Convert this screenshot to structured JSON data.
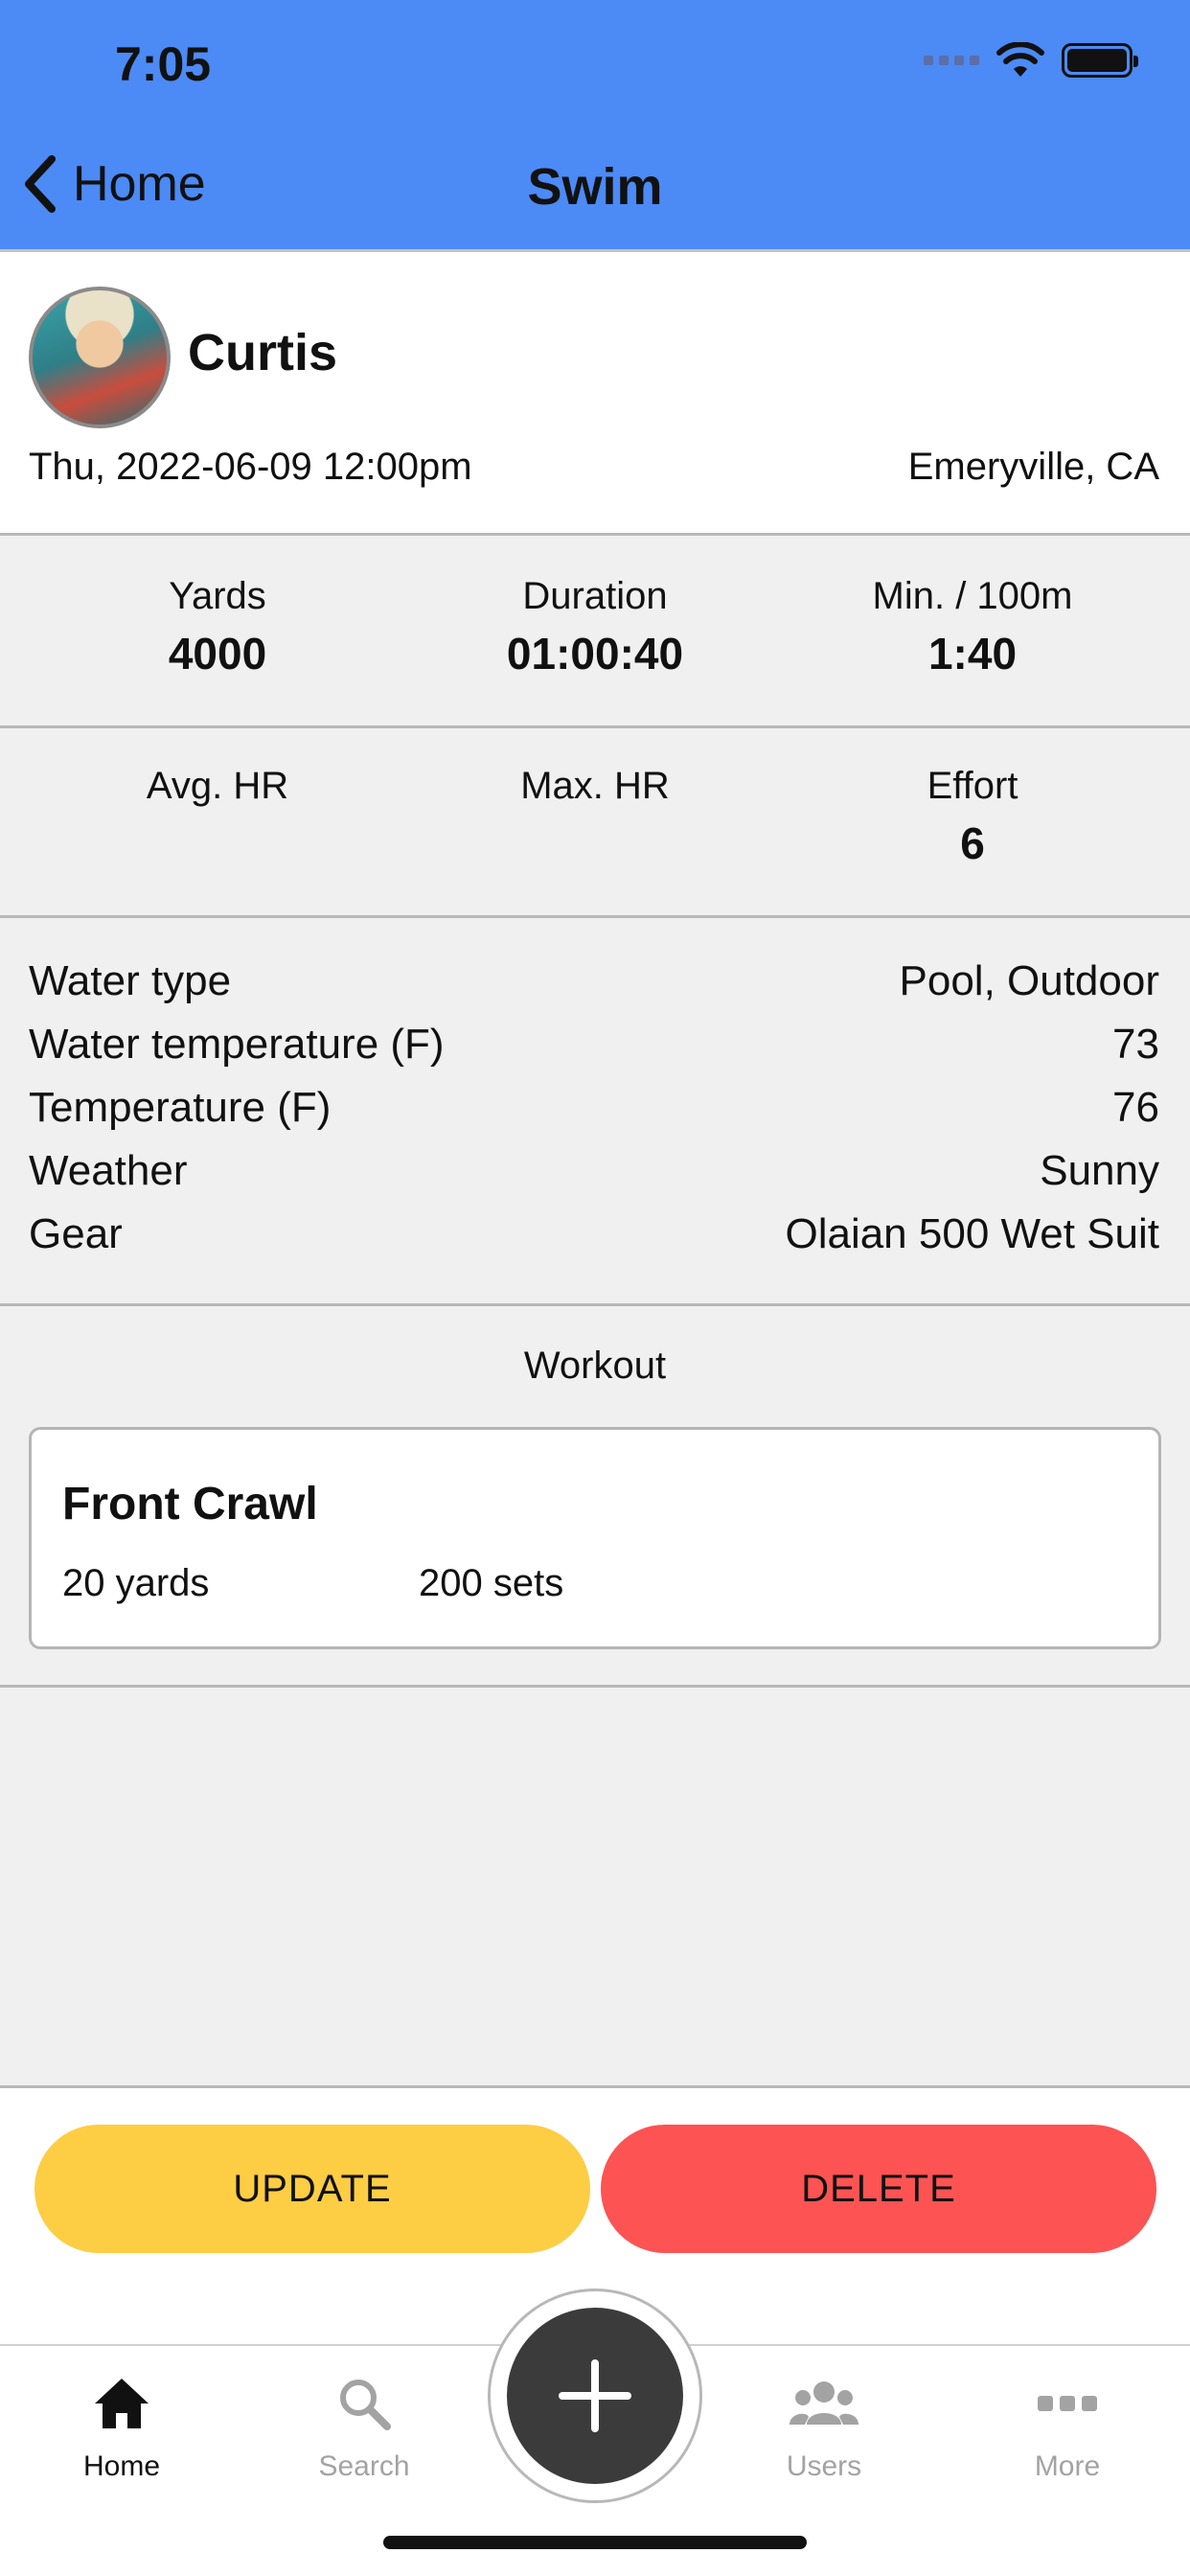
{
  "status_bar": {
    "time": "7:05"
  },
  "nav": {
    "back_label": "Home",
    "title": "Swim"
  },
  "profile": {
    "name": "Curtis",
    "datetime": "Thu, 2022-06-09 12:00pm",
    "location": "Emeryville, CA"
  },
  "stats": [
    {
      "label": "Yards",
      "value": "4000"
    },
    {
      "label": "Duration",
      "value": "01:00:40"
    },
    {
      "label": "Min. / 100m",
      "value": "1:40"
    },
    {
      "label": "Avg. HR",
      "value": ""
    },
    {
      "label": "Max. HR",
      "value": ""
    },
    {
      "label": "Effort",
      "value": "6"
    }
  ],
  "details": [
    {
      "label": "Water type",
      "value": "Pool, Outdoor"
    },
    {
      "label": "Water temperature (F)",
      "value": "73"
    },
    {
      "label": "Temperature (F)",
      "value": "76"
    },
    {
      "label": "Weather",
      "value": "Sunny"
    },
    {
      "label": "Gear",
      "value": "Olaian 500 Wet Suit"
    }
  ],
  "workout": {
    "heading": "Workout",
    "items": [
      {
        "name": "Front Crawl",
        "distance": "20 yards",
        "sets": "200 sets"
      }
    ]
  },
  "actions": {
    "update_label": "UPDATE",
    "delete_label": "DELETE"
  },
  "tabbar": {
    "tabs": [
      {
        "label": "Home",
        "icon": "home-icon",
        "active": true
      },
      {
        "label": "Search",
        "icon": "search-icon",
        "active": false
      },
      {
        "label": "Users",
        "icon": "users-icon",
        "active": false
      },
      {
        "label": "More",
        "icon": "more-icon",
        "active": false
      }
    ],
    "add_icon": "plus-icon"
  },
  "colors": {
    "header": "#4c8af5",
    "update": "#fdcd44",
    "delete": "#fd5353",
    "fab": "#3b3b3b",
    "background": "#f0f0f0"
  }
}
